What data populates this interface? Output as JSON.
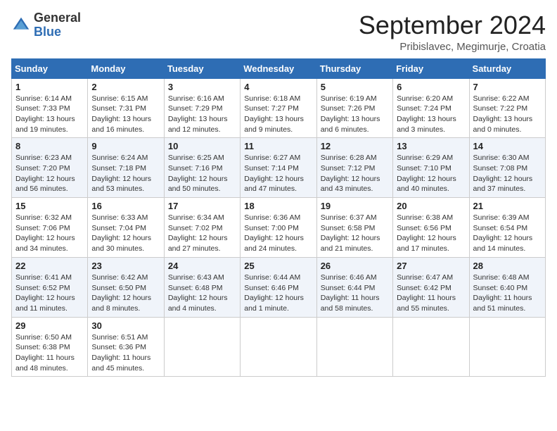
{
  "header": {
    "logo_general": "General",
    "logo_blue": "Blue",
    "month_title": "September 2024",
    "location": "Pribislavec, Megimurje, Croatia"
  },
  "columns": [
    "Sunday",
    "Monday",
    "Tuesday",
    "Wednesday",
    "Thursday",
    "Friday",
    "Saturday"
  ],
  "weeks": [
    [
      {
        "day": "1",
        "sunrise": "Sunrise: 6:14 AM",
        "sunset": "Sunset: 7:33 PM",
        "daylight": "Daylight: 13 hours and 19 minutes."
      },
      {
        "day": "2",
        "sunrise": "Sunrise: 6:15 AM",
        "sunset": "Sunset: 7:31 PM",
        "daylight": "Daylight: 13 hours and 16 minutes."
      },
      {
        "day": "3",
        "sunrise": "Sunrise: 6:16 AM",
        "sunset": "Sunset: 7:29 PM",
        "daylight": "Daylight: 13 hours and 12 minutes."
      },
      {
        "day": "4",
        "sunrise": "Sunrise: 6:18 AM",
        "sunset": "Sunset: 7:27 PM",
        "daylight": "Daylight: 13 hours and 9 minutes."
      },
      {
        "day": "5",
        "sunrise": "Sunrise: 6:19 AM",
        "sunset": "Sunset: 7:26 PM",
        "daylight": "Daylight: 13 hours and 6 minutes."
      },
      {
        "day": "6",
        "sunrise": "Sunrise: 6:20 AM",
        "sunset": "Sunset: 7:24 PM",
        "daylight": "Daylight: 13 hours and 3 minutes."
      },
      {
        "day": "7",
        "sunrise": "Sunrise: 6:22 AM",
        "sunset": "Sunset: 7:22 PM",
        "daylight": "Daylight: 13 hours and 0 minutes."
      }
    ],
    [
      {
        "day": "8",
        "sunrise": "Sunrise: 6:23 AM",
        "sunset": "Sunset: 7:20 PM",
        "daylight": "Daylight: 12 hours and 56 minutes."
      },
      {
        "day": "9",
        "sunrise": "Sunrise: 6:24 AM",
        "sunset": "Sunset: 7:18 PM",
        "daylight": "Daylight: 12 hours and 53 minutes."
      },
      {
        "day": "10",
        "sunrise": "Sunrise: 6:25 AM",
        "sunset": "Sunset: 7:16 PM",
        "daylight": "Daylight: 12 hours and 50 minutes."
      },
      {
        "day": "11",
        "sunrise": "Sunrise: 6:27 AM",
        "sunset": "Sunset: 7:14 PM",
        "daylight": "Daylight: 12 hours and 47 minutes."
      },
      {
        "day": "12",
        "sunrise": "Sunrise: 6:28 AM",
        "sunset": "Sunset: 7:12 PM",
        "daylight": "Daylight: 12 hours and 43 minutes."
      },
      {
        "day": "13",
        "sunrise": "Sunrise: 6:29 AM",
        "sunset": "Sunset: 7:10 PM",
        "daylight": "Daylight: 12 hours and 40 minutes."
      },
      {
        "day": "14",
        "sunrise": "Sunrise: 6:30 AM",
        "sunset": "Sunset: 7:08 PM",
        "daylight": "Daylight: 12 hours and 37 minutes."
      }
    ],
    [
      {
        "day": "15",
        "sunrise": "Sunrise: 6:32 AM",
        "sunset": "Sunset: 7:06 PM",
        "daylight": "Daylight: 12 hours and 34 minutes."
      },
      {
        "day": "16",
        "sunrise": "Sunrise: 6:33 AM",
        "sunset": "Sunset: 7:04 PM",
        "daylight": "Daylight: 12 hours and 30 minutes."
      },
      {
        "day": "17",
        "sunrise": "Sunrise: 6:34 AM",
        "sunset": "Sunset: 7:02 PM",
        "daylight": "Daylight: 12 hours and 27 minutes."
      },
      {
        "day": "18",
        "sunrise": "Sunrise: 6:36 AM",
        "sunset": "Sunset: 7:00 PM",
        "daylight": "Daylight: 12 hours and 24 minutes."
      },
      {
        "day": "19",
        "sunrise": "Sunrise: 6:37 AM",
        "sunset": "Sunset: 6:58 PM",
        "daylight": "Daylight: 12 hours and 21 minutes."
      },
      {
        "day": "20",
        "sunrise": "Sunrise: 6:38 AM",
        "sunset": "Sunset: 6:56 PM",
        "daylight": "Daylight: 12 hours and 17 minutes."
      },
      {
        "day": "21",
        "sunrise": "Sunrise: 6:39 AM",
        "sunset": "Sunset: 6:54 PM",
        "daylight": "Daylight: 12 hours and 14 minutes."
      }
    ],
    [
      {
        "day": "22",
        "sunrise": "Sunrise: 6:41 AM",
        "sunset": "Sunset: 6:52 PM",
        "daylight": "Daylight: 12 hours and 11 minutes."
      },
      {
        "day": "23",
        "sunrise": "Sunrise: 6:42 AM",
        "sunset": "Sunset: 6:50 PM",
        "daylight": "Daylight: 12 hours and 8 minutes."
      },
      {
        "day": "24",
        "sunrise": "Sunrise: 6:43 AM",
        "sunset": "Sunset: 6:48 PM",
        "daylight": "Daylight: 12 hours and 4 minutes."
      },
      {
        "day": "25",
        "sunrise": "Sunrise: 6:44 AM",
        "sunset": "Sunset: 6:46 PM",
        "daylight": "Daylight: 12 hours and 1 minute."
      },
      {
        "day": "26",
        "sunrise": "Sunrise: 6:46 AM",
        "sunset": "Sunset: 6:44 PM",
        "daylight": "Daylight: 11 hours and 58 minutes."
      },
      {
        "day": "27",
        "sunrise": "Sunrise: 6:47 AM",
        "sunset": "Sunset: 6:42 PM",
        "daylight": "Daylight: 11 hours and 55 minutes."
      },
      {
        "day": "28",
        "sunrise": "Sunrise: 6:48 AM",
        "sunset": "Sunset: 6:40 PM",
        "daylight": "Daylight: 11 hours and 51 minutes."
      }
    ],
    [
      {
        "day": "29",
        "sunrise": "Sunrise: 6:50 AM",
        "sunset": "Sunset: 6:38 PM",
        "daylight": "Daylight: 11 hours and 48 minutes."
      },
      {
        "day": "30",
        "sunrise": "Sunrise: 6:51 AM",
        "sunset": "Sunset: 6:36 PM",
        "daylight": "Daylight: 11 hours and 45 minutes."
      },
      null,
      null,
      null,
      null,
      null
    ]
  ]
}
